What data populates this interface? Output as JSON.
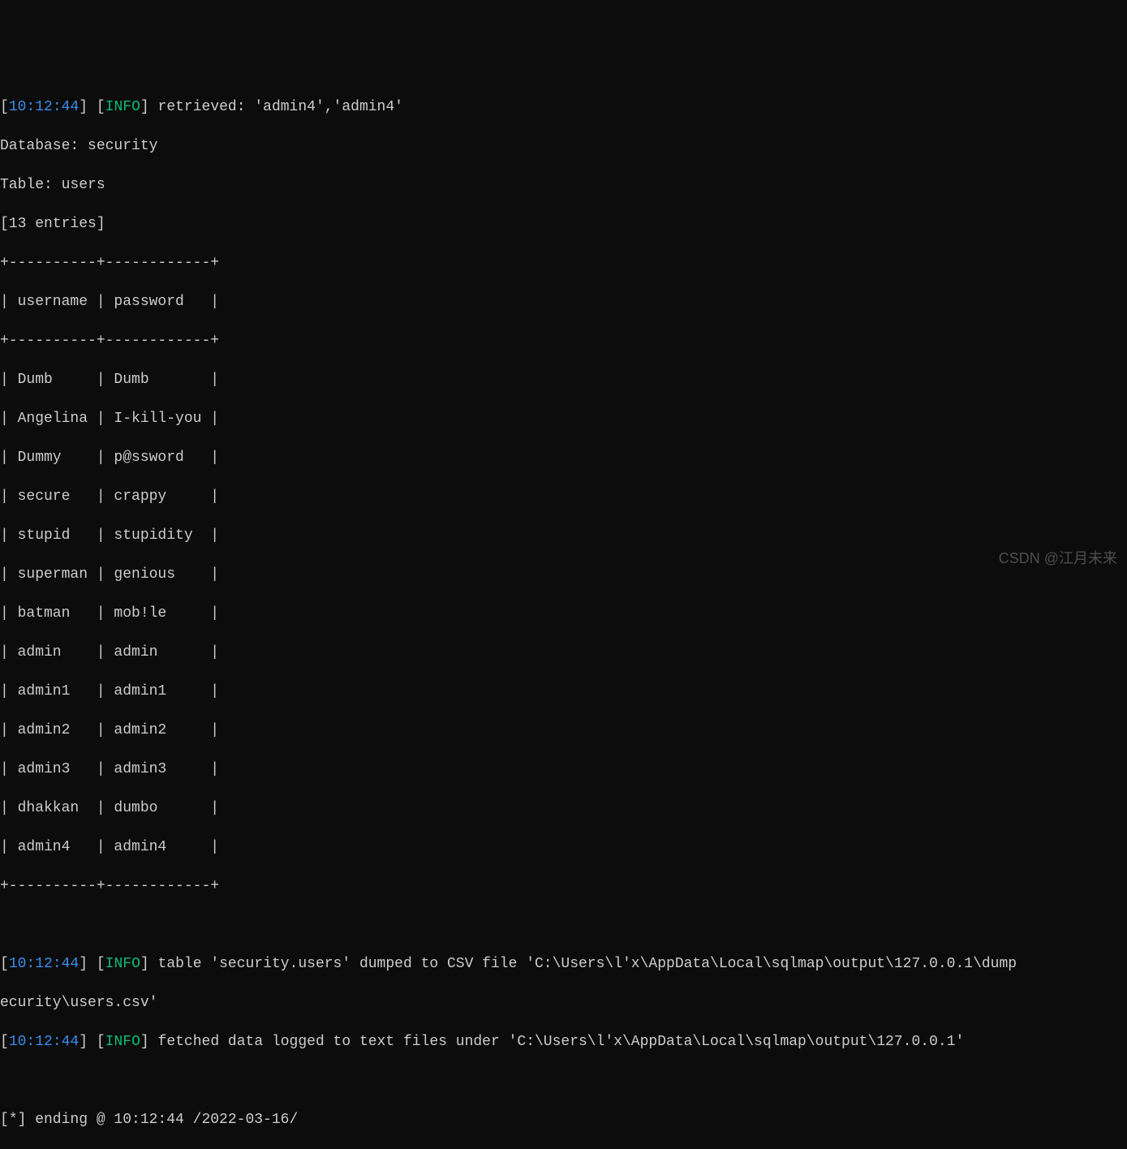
{
  "log1": {
    "timestamp": "10:12:44",
    "level": "INFO",
    "message": "retrieved: 'admin4','admin4'"
  },
  "meta": {
    "database_label": "Database: security",
    "table_label": "Table: users",
    "entries_label": "[13 entries]"
  },
  "table": {
    "border_top": "+----------+------------+",
    "header_row": "| username | password   |",
    "border_mid": "+----------+------------+",
    "rows": [
      "| Dumb     | Dumb       |",
      "| Angelina | I-kill-you |",
      "| Dummy    | p@ssword   |",
      "| secure   | crappy     |",
      "| stupid   | stupidity  |",
      "| superman | genious    |",
      "| batman   | mob!le     |",
      "| admin    | admin      |",
      "| admin1   | admin1     |",
      "| admin2   | admin2     |",
      "| admin3   | admin3     |",
      "| dhakkan  | dumbo      |",
      "| admin4   | admin4     |"
    ],
    "border_bot": "+----------+------------+"
  },
  "log2": {
    "timestamp": "10:12:44",
    "level": "INFO",
    "message_line1": "table 'security.users' dumped to CSV file 'C:\\Users\\l'x\\AppData\\Local\\sqlmap\\output\\127.0.0.1\\dump",
    "message_line2": "ecurity\\users.csv'"
  },
  "log3": {
    "timestamp": "10:12:44",
    "level": "INFO",
    "message": "fetched data logged to text files under 'C:\\Users\\l'x\\AppData\\Local\\sqlmap\\output\\127.0.0.1'"
  },
  "ending": "[*] ending @ 10:12:44 /2022-03-16/",
  "watermark": "CSDN @江月未来",
  "brackets": {
    "open": "[",
    "close": "]"
  }
}
